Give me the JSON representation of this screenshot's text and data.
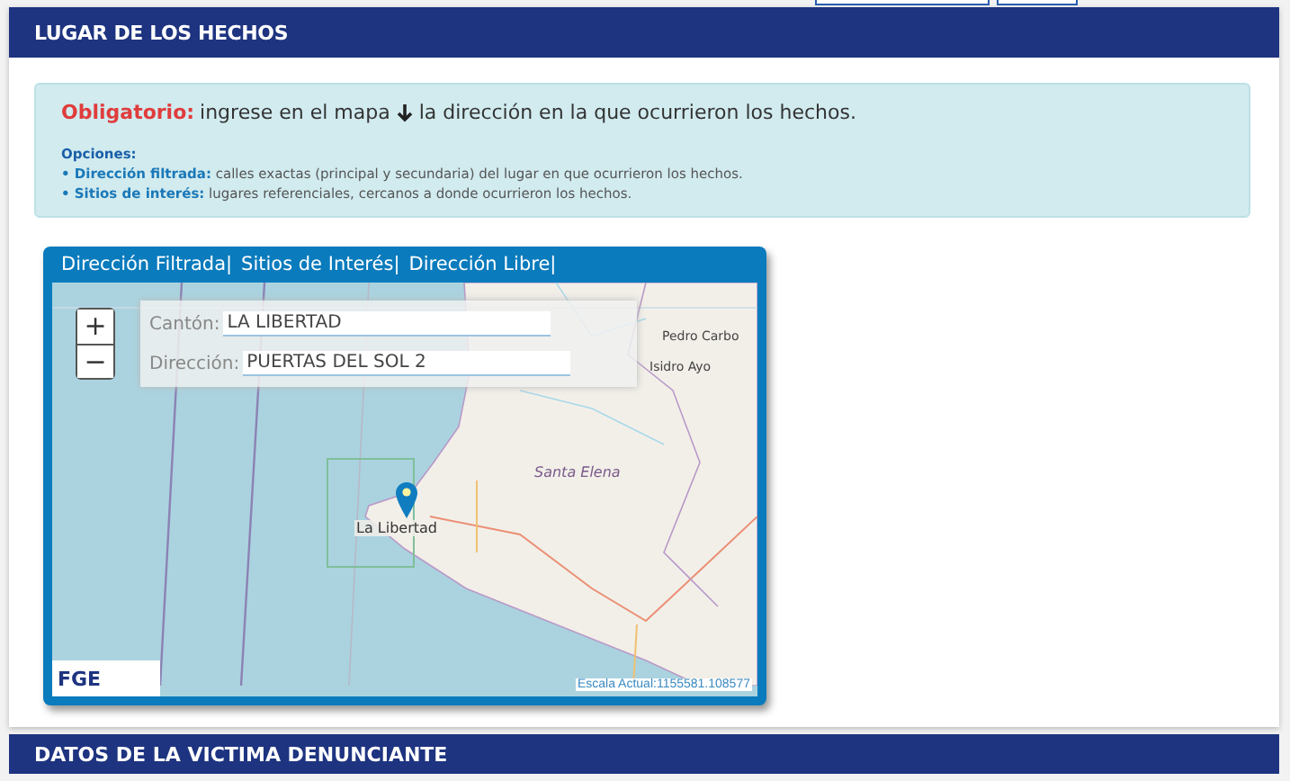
{
  "section": {
    "title": "LUGAR DE LOS HECHOS"
  },
  "notice": {
    "label": "Obligatorio:",
    "text_before": "ingrese en el mapa",
    "text_after": "la dirección en la que ocurrieron los hechos.",
    "options_title": "Opciones:",
    "options": [
      "**• Dirección filtrada:** calles exactas (principal y secundaria) del lugar en que ocurrieron los hechos.",
      "**• Sitios de interés:** lugares referenciales, cercanos a donde ocurrieron los hechos."
    ]
  },
  "map": {
    "tabs": [
      {
        "label": "Dirección Filtrada|"
      },
      {
        "label": "Sitios de Interés|"
      },
      {
        "label": "Dirección Libre|"
      }
    ],
    "zoom": [
      "+",
      "−"
    ],
    "fields": [
      {
        "label": "Cantón:",
        "value": "LA LIBERTAD"
      },
      {
        "label": "Dirección:",
        "value": "PUERTAS DEL SOL 2"
      }
    ],
    "place_labels": [
      {
        "text": "Pedro Carbo",
        "kind": "town"
      },
      {
        "text": "Isidro Ayo",
        "kind": "town"
      },
      {
        "text": "Santa Elena",
        "kind": "region"
      },
      {
        "text": "La Libertad",
        "kind": "city"
      }
    ],
    "logo": "FGE",
    "scale": "Escala Actual:1155581.108577"
  },
  "next_section": {
    "title": "DATOS DE LA VICTIMA DENUNCIANTE"
  }
}
